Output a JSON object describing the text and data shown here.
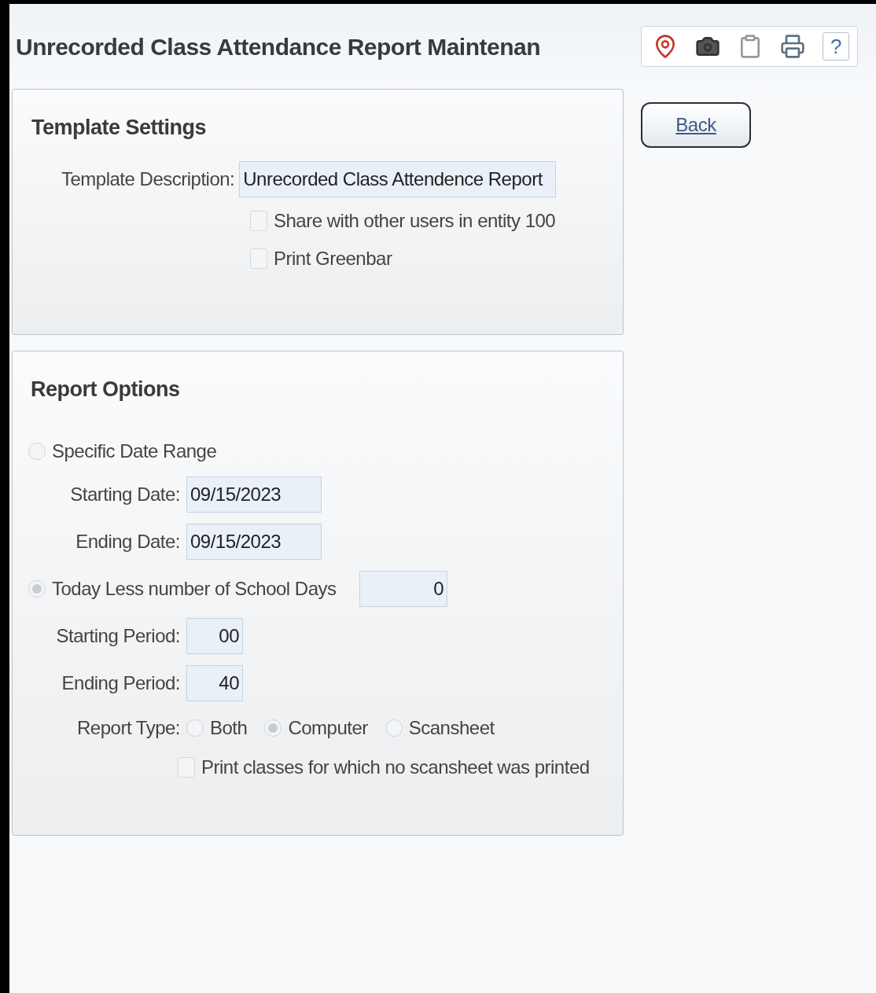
{
  "title": "Unrecorded Class Attendance Report Maintenan",
  "toolbar": {
    "help_label": "?"
  },
  "back_button": {
    "label": "Back"
  },
  "template_settings": {
    "heading": "Template Settings",
    "description_label": "Template Description:",
    "description_value": "Unrecorded Class Attendence Report",
    "checkboxes": [
      {
        "label": "Share with other users in entity 100",
        "checked": false
      },
      {
        "label": "Print Greenbar",
        "checked": false
      }
    ]
  },
  "report_options": {
    "heading": "Report Options",
    "date_modes": [
      {
        "label": "Specific Date Range",
        "selected": false
      },
      {
        "label": "Today Less number of School Days",
        "selected": true,
        "value": "0"
      }
    ],
    "starting_date": {
      "label": "Starting Date:",
      "value": "09/15/2023"
    },
    "ending_date": {
      "label": "Ending Date:",
      "value": "09/15/2023"
    },
    "starting_period": {
      "label": "Starting Period:",
      "value": "00"
    },
    "ending_period": {
      "label": "Ending Period:",
      "value": "40"
    },
    "report_type": {
      "label": "Report Type:",
      "options": [
        {
          "label": "Both",
          "selected": false
        },
        {
          "label": "Computer",
          "selected": true
        },
        {
          "label": "Scansheet",
          "selected": false
        }
      ]
    },
    "print_classes": {
      "label": "Print classes for which no scansheet was printed",
      "checked": false
    }
  }
}
